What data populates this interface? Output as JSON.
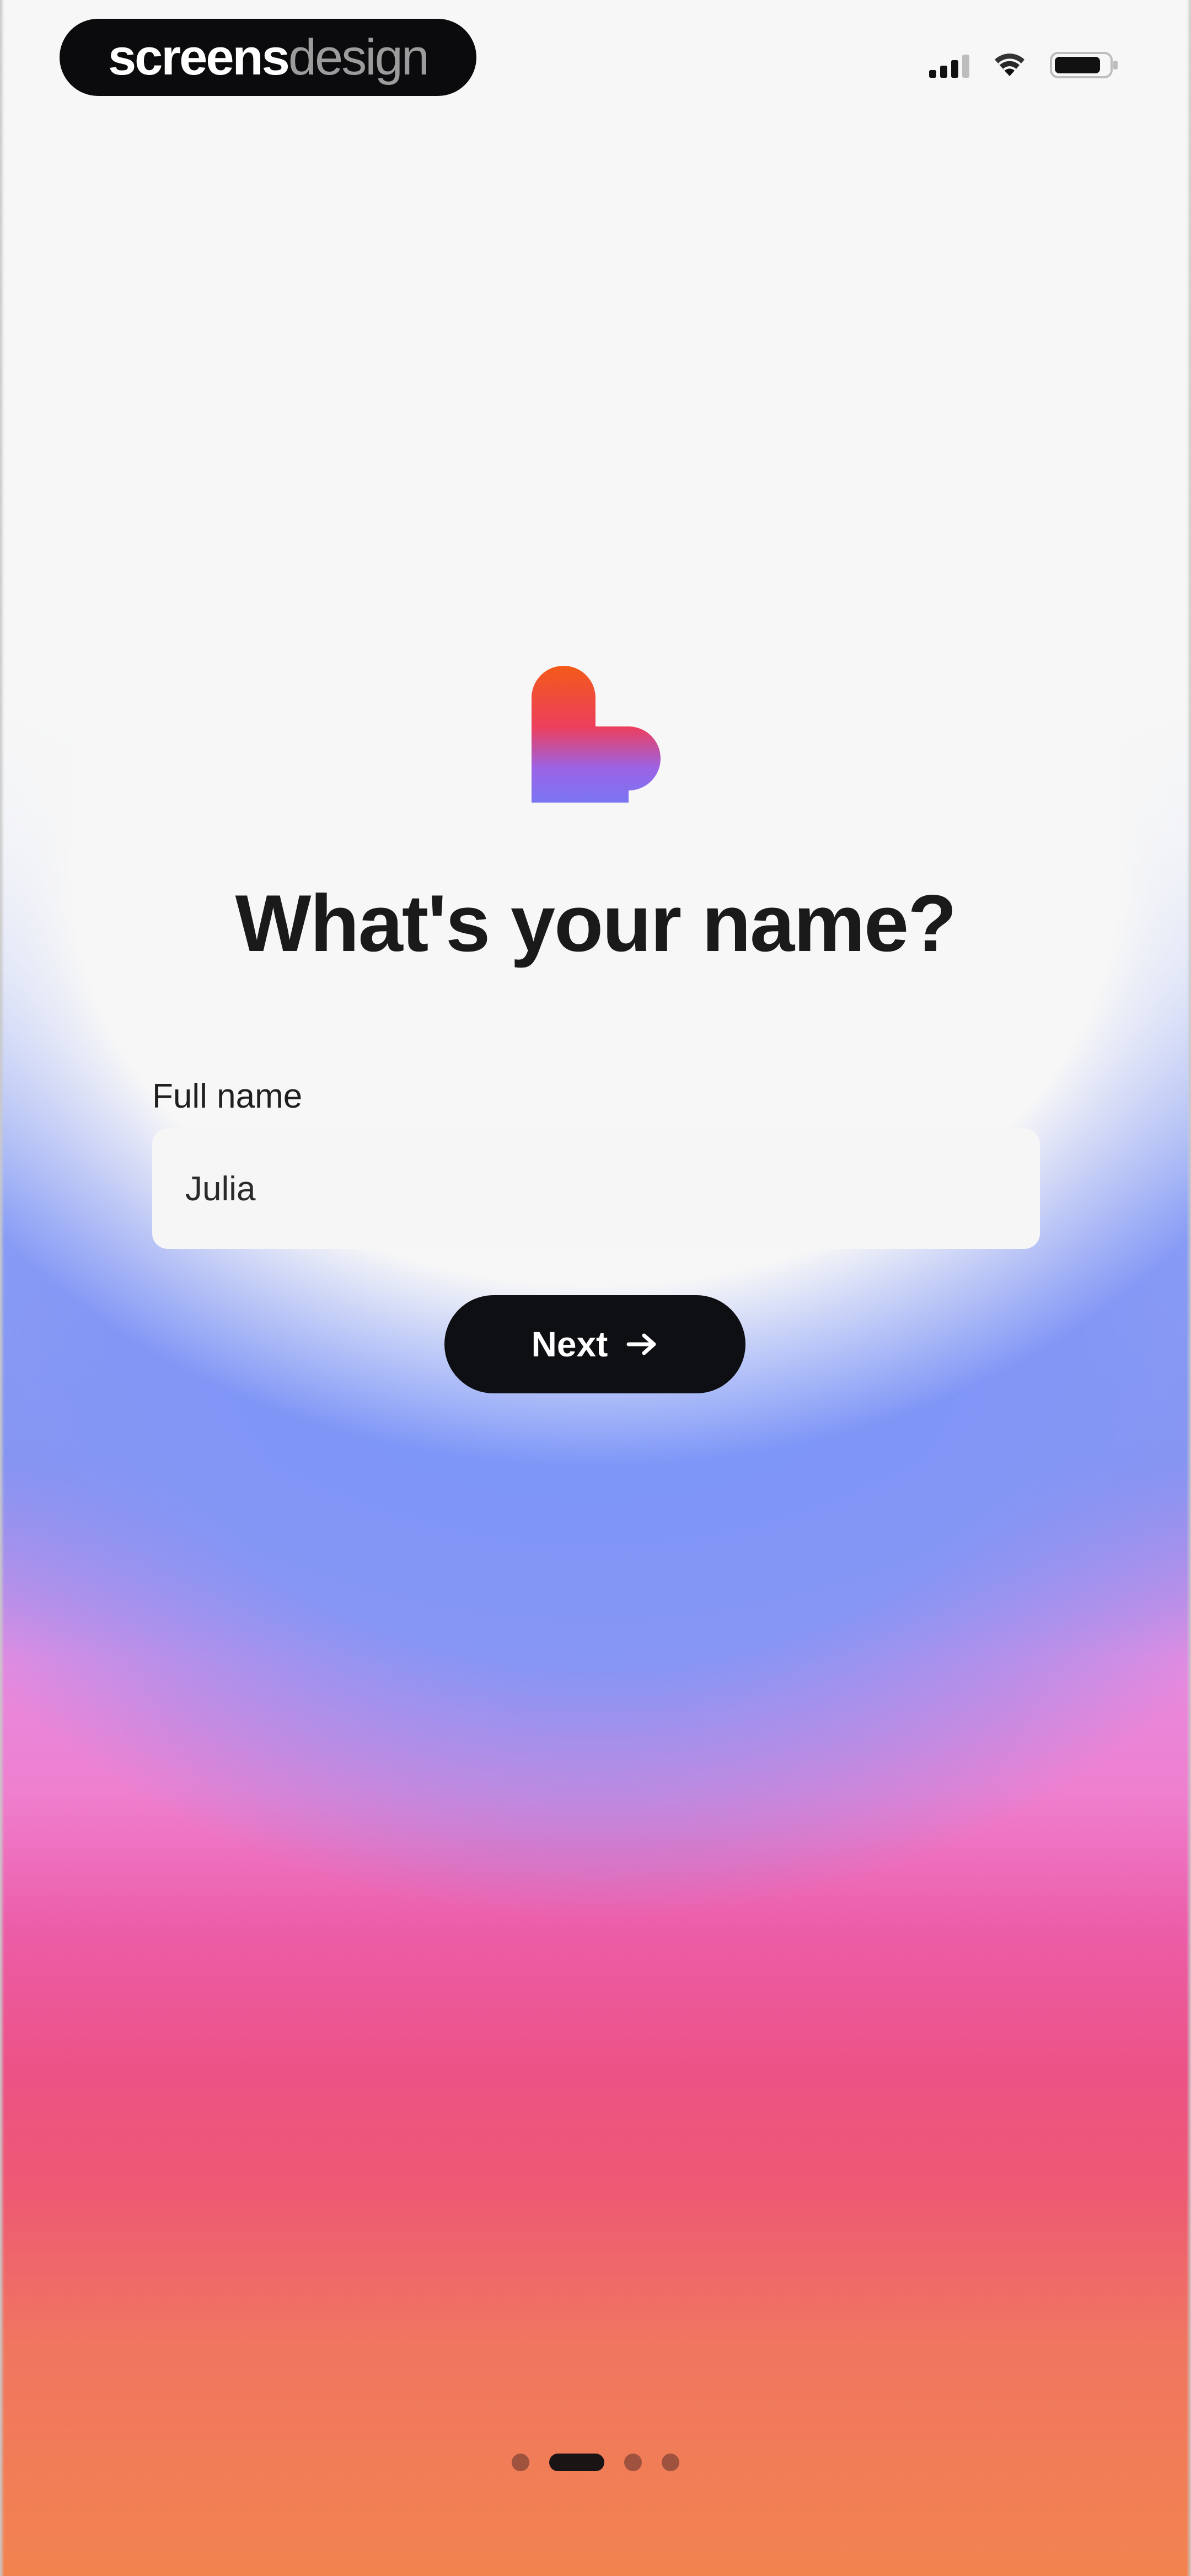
{
  "brand": {
    "part1": "screens",
    "part2": "design"
  },
  "status_bar": {
    "icons": [
      "signal-icon",
      "wifi-icon",
      "battery-icon"
    ]
  },
  "logo": {
    "icon": "heart-logo-icon",
    "colors": [
      "#f35a18",
      "#8a6cf0"
    ]
  },
  "onboarding": {
    "title": "What's your name?",
    "field_label": "Full name",
    "field_value": "Julia",
    "next_label": "Next",
    "next_icon": "arrow-right-icon"
  },
  "pager": {
    "total": 4,
    "active_index": 1
  },
  "colors": {
    "accent_dark": "#0e0f12",
    "gradient_blue": "#8b93ef",
    "gradient_pink": "#ec5286",
    "gradient_orange": "#f2834f"
  }
}
